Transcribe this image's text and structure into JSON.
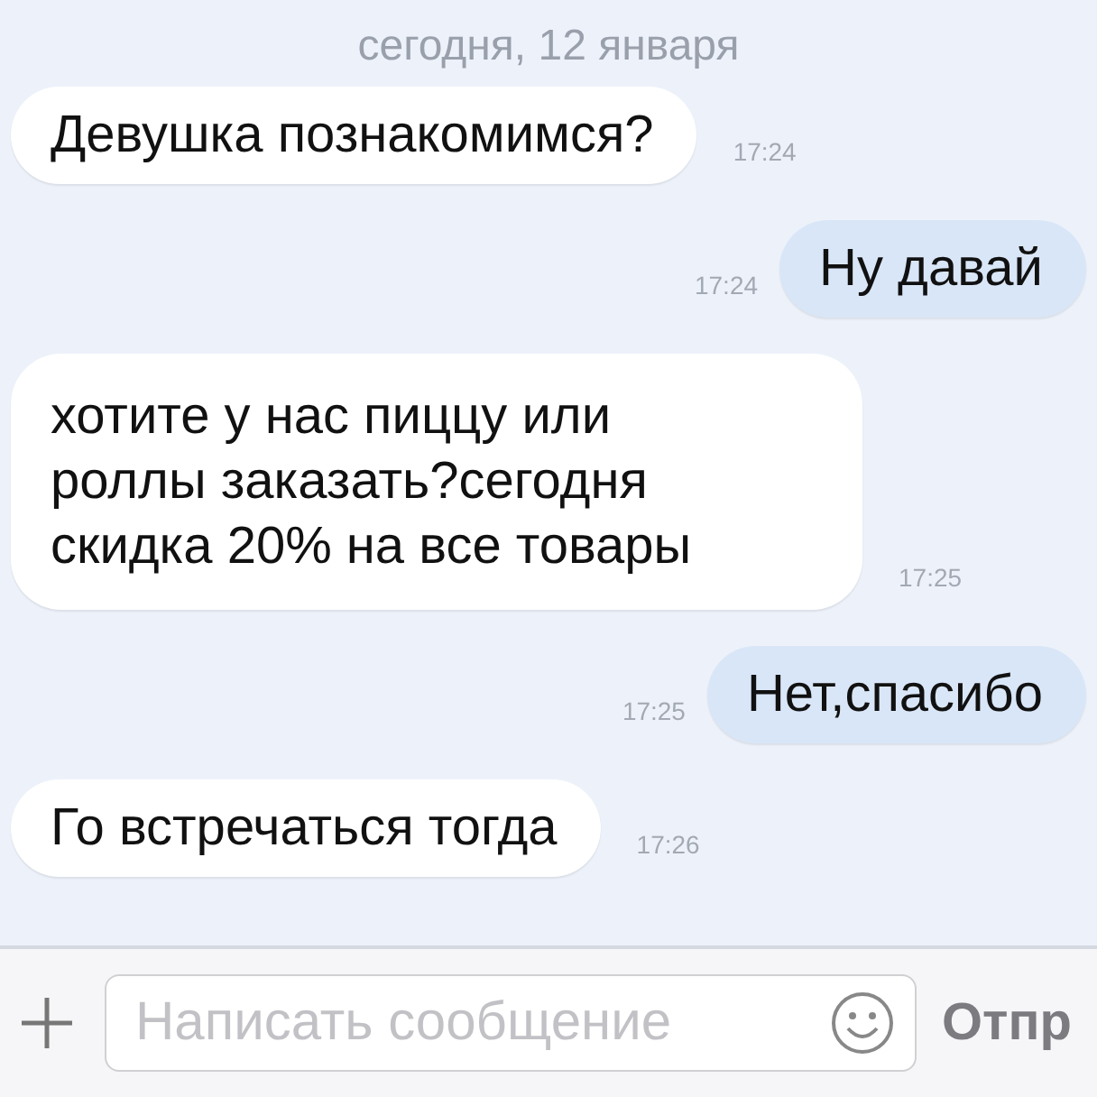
{
  "date_separator": "сегодня, 12 января",
  "messages": [
    {
      "text": "Девушка познакомимся?",
      "time": "17:24",
      "outgoing": false
    },
    {
      "text": "Ну давай",
      "time": "17:24",
      "outgoing": true
    },
    {
      "text": "хотите у нас пиццу или роллы заказать?сегодня скидка 20% на все товары",
      "time": "17:25",
      "outgoing": false
    },
    {
      "text": "Нет,спасибо",
      "time": "17:25",
      "outgoing": true
    },
    {
      "text": "Го встречаться тогда",
      "time": "17:26",
      "outgoing": false
    }
  ],
  "composer": {
    "placeholder": "Написать сообщение",
    "send_label": "Отпр"
  }
}
